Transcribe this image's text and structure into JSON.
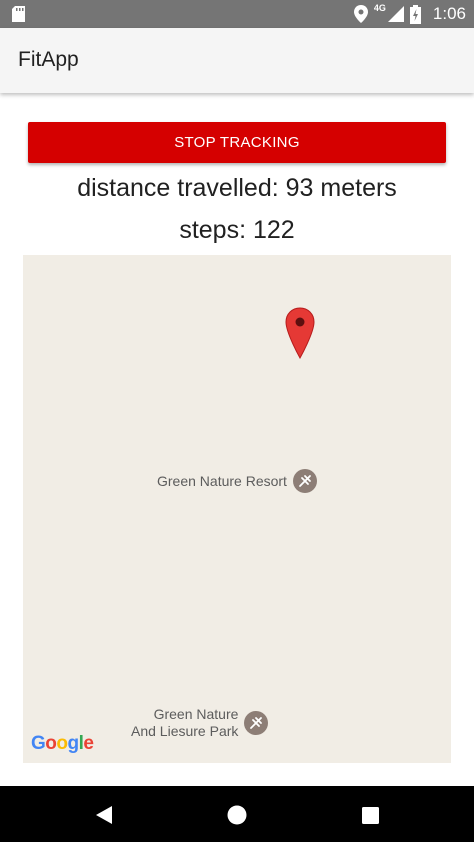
{
  "status_bar": {
    "network_label": "4G",
    "time": "1:06",
    "icons": [
      "sd-card-icon",
      "location-icon",
      "signal-icon",
      "battery-charging-icon"
    ]
  },
  "app_bar": {
    "title": "FitApp"
  },
  "main": {
    "stop_button_label": "STOP TRACKING",
    "distance_text": "distance travelled: 93 meters",
    "steps_text": "steps: 122"
  },
  "map": {
    "poi_resort": "Green Nature Resort",
    "poi_park_line1": "Green Nature",
    "poi_park_line2": "And Liesure Park",
    "google_logo": [
      "G",
      "o",
      "o",
      "g",
      "l",
      "e"
    ],
    "marker_icon": "map-pin-icon"
  },
  "nav_bar": {
    "icons": [
      "back-icon",
      "home-icon",
      "recents-icon"
    ]
  },
  "colors": {
    "status_bar": "#757575",
    "app_bar": "#f5f5f5",
    "accent_button": "#d50000",
    "map_background": "#f1ede5",
    "marker": "#e53935",
    "poi_icon": "#8d7e76",
    "nav_bar": "#000000"
  }
}
